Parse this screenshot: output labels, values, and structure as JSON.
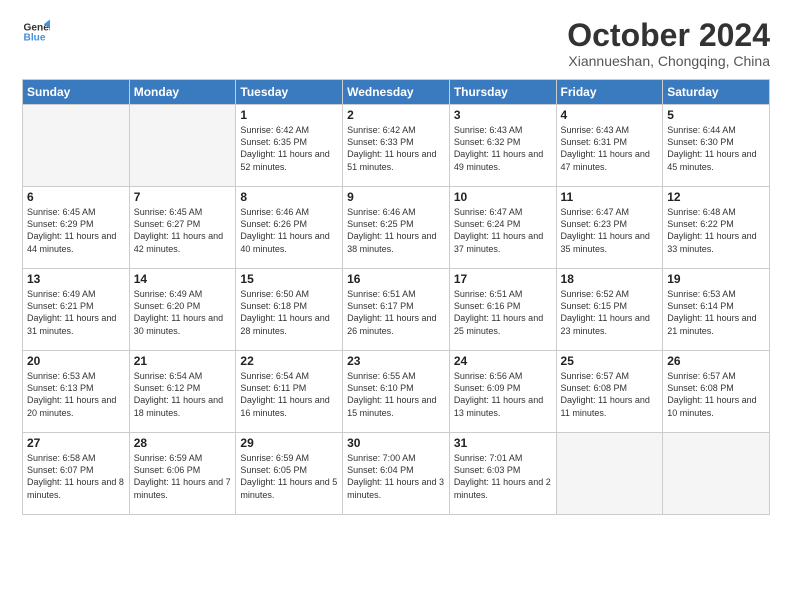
{
  "header": {
    "logo_line1": "General",
    "logo_line2": "Blue",
    "month": "October 2024",
    "location": "Xiannueshan, Chongqing, China"
  },
  "weekdays": [
    "Sunday",
    "Monday",
    "Tuesday",
    "Wednesday",
    "Thursday",
    "Friday",
    "Saturday"
  ],
  "weeks": [
    [
      {
        "day": "",
        "empty": true
      },
      {
        "day": "",
        "empty": true
      },
      {
        "day": "1",
        "rise": "6:42 AM",
        "set": "6:35 PM",
        "daylight": "11 hours and 52 minutes."
      },
      {
        "day": "2",
        "rise": "6:42 AM",
        "set": "6:33 PM",
        "daylight": "11 hours and 51 minutes."
      },
      {
        "day": "3",
        "rise": "6:43 AM",
        "set": "6:32 PM",
        "daylight": "11 hours and 49 minutes."
      },
      {
        "day": "4",
        "rise": "6:43 AM",
        "set": "6:31 PM",
        "daylight": "11 hours and 47 minutes."
      },
      {
        "day": "5",
        "rise": "6:44 AM",
        "set": "6:30 PM",
        "daylight": "11 hours and 45 minutes."
      }
    ],
    [
      {
        "day": "6",
        "rise": "6:45 AM",
        "set": "6:29 PM",
        "daylight": "11 hours and 44 minutes."
      },
      {
        "day": "7",
        "rise": "6:45 AM",
        "set": "6:27 PM",
        "daylight": "11 hours and 42 minutes."
      },
      {
        "day": "8",
        "rise": "6:46 AM",
        "set": "6:26 PM",
        "daylight": "11 hours and 40 minutes."
      },
      {
        "day": "9",
        "rise": "6:46 AM",
        "set": "6:25 PM",
        "daylight": "11 hours and 38 minutes."
      },
      {
        "day": "10",
        "rise": "6:47 AM",
        "set": "6:24 PM",
        "daylight": "11 hours and 37 minutes."
      },
      {
        "day": "11",
        "rise": "6:47 AM",
        "set": "6:23 PM",
        "daylight": "11 hours and 35 minutes."
      },
      {
        "day": "12",
        "rise": "6:48 AM",
        "set": "6:22 PM",
        "daylight": "11 hours and 33 minutes."
      }
    ],
    [
      {
        "day": "13",
        "rise": "6:49 AM",
        "set": "6:21 PM",
        "daylight": "11 hours and 31 minutes."
      },
      {
        "day": "14",
        "rise": "6:49 AM",
        "set": "6:20 PM",
        "daylight": "11 hours and 30 minutes."
      },
      {
        "day": "15",
        "rise": "6:50 AM",
        "set": "6:18 PM",
        "daylight": "11 hours and 28 minutes."
      },
      {
        "day": "16",
        "rise": "6:51 AM",
        "set": "6:17 PM",
        "daylight": "11 hours and 26 minutes."
      },
      {
        "day": "17",
        "rise": "6:51 AM",
        "set": "6:16 PM",
        "daylight": "11 hours and 25 minutes."
      },
      {
        "day": "18",
        "rise": "6:52 AM",
        "set": "6:15 PM",
        "daylight": "11 hours and 23 minutes."
      },
      {
        "day": "19",
        "rise": "6:53 AM",
        "set": "6:14 PM",
        "daylight": "11 hours and 21 minutes."
      }
    ],
    [
      {
        "day": "20",
        "rise": "6:53 AM",
        "set": "6:13 PM",
        "daylight": "11 hours and 20 minutes."
      },
      {
        "day": "21",
        "rise": "6:54 AM",
        "set": "6:12 PM",
        "daylight": "11 hours and 18 minutes."
      },
      {
        "day": "22",
        "rise": "6:54 AM",
        "set": "6:11 PM",
        "daylight": "11 hours and 16 minutes."
      },
      {
        "day": "23",
        "rise": "6:55 AM",
        "set": "6:10 PM",
        "daylight": "11 hours and 15 minutes."
      },
      {
        "day": "24",
        "rise": "6:56 AM",
        "set": "6:09 PM",
        "daylight": "11 hours and 13 minutes."
      },
      {
        "day": "25",
        "rise": "6:57 AM",
        "set": "6:08 PM",
        "daylight": "11 hours and 11 minutes."
      },
      {
        "day": "26",
        "rise": "6:57 AM",
        "set": "6:08 PM",
        "daylight": "11 hours and 10 minutes."
      }
    ],
    [
      {
        "day": "27",
        "rise": "6:58 AM",
        "set": "6:07 PM",
        "daylight": "11 hours and 8 minutes."
      },
      {
        "day": "28",
        "rise": "6:59 AM",
        "set": "6:06 PM",
        "daylight": "11 hours and 7 minutes."
      },
      {
        "day": "29",
        "rise": "6:59 AM",
        "set": "6:05 PM",
        "daylight": "11 hours and 5 minutes."
      },
      {
        "day": "30",
        "rise": "7:00 AM",
        "set": "6:04 PM",
        "daylight": "11 hours and 3 minutes."
      },
      {
        "day": "31",
        "rise": "7:01 AM",
        "set": "6:03 PM",
        "daylight": "11 hours and 2 minutes."
      },
      {
        "day": "",
        "empty": true
      },
      {
        "day": "",
        "empty": true
      }
    ]
  ],
  "labels": {
    "sunrise": "Sunrise:",
    "sunset": "Sunset:",
    "daylight": "Daylight:"
  }
}
